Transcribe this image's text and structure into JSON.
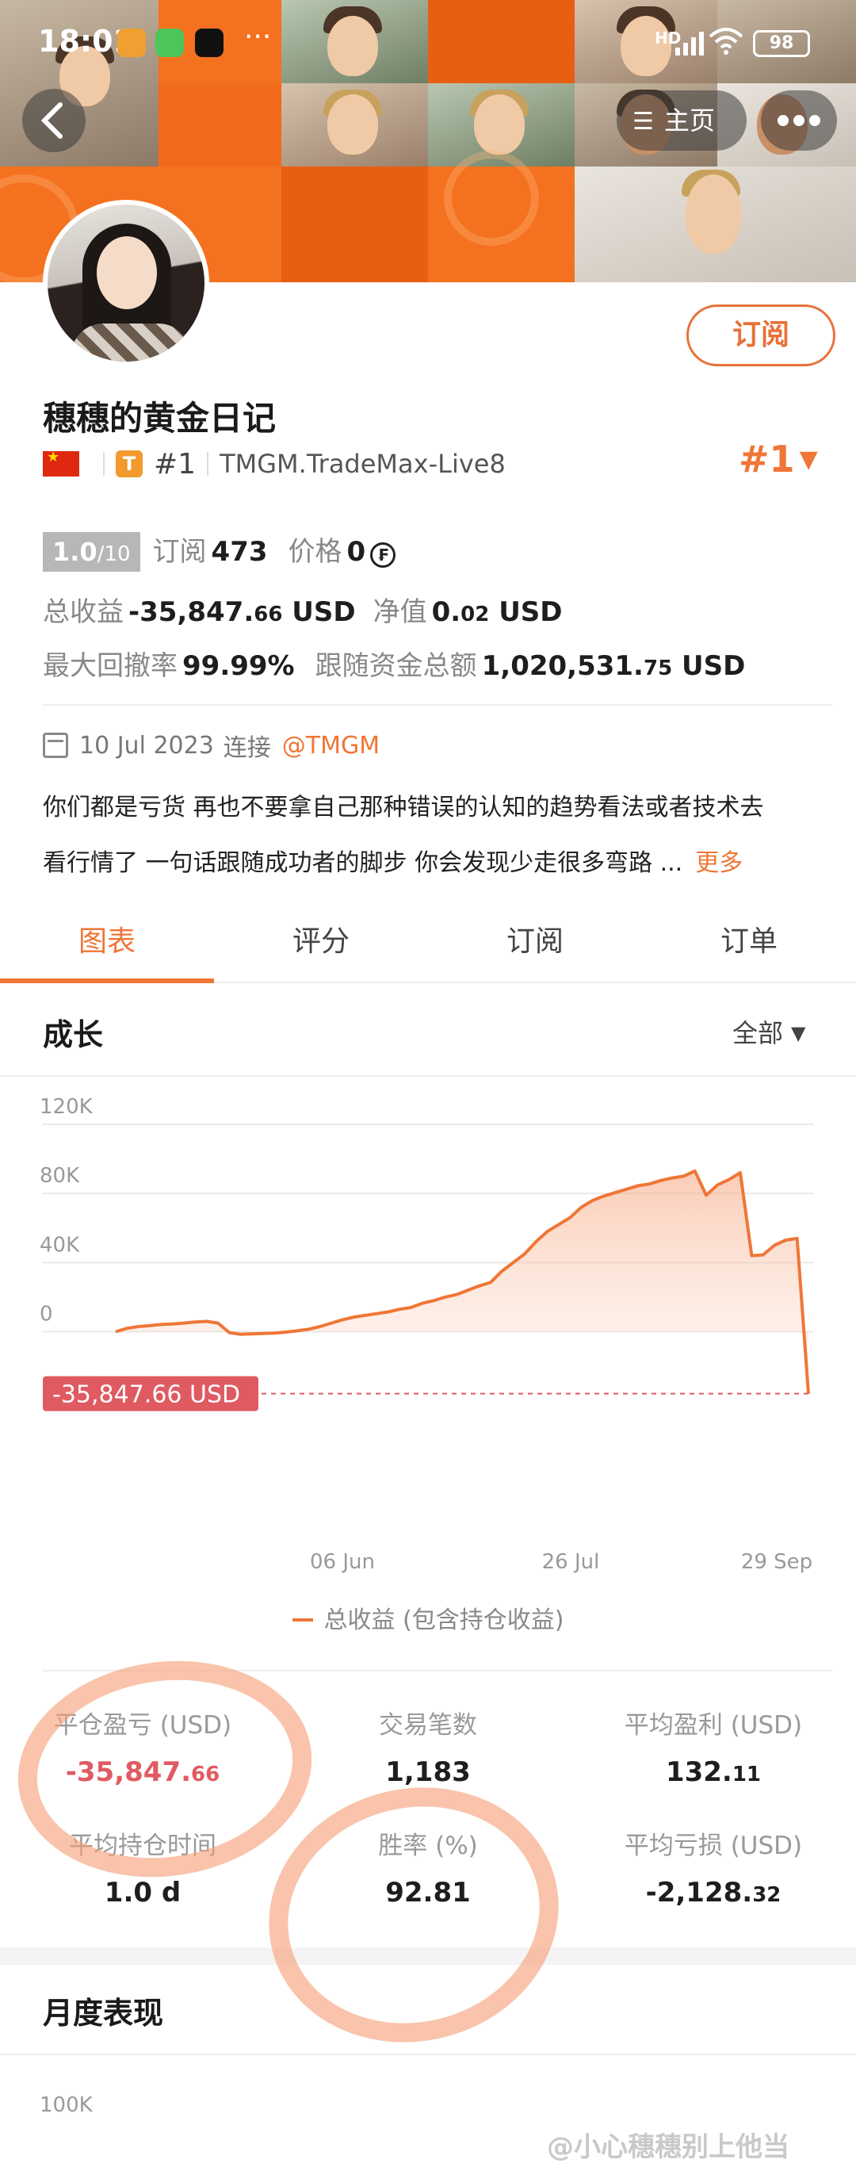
{
  "status_bar": {
    "time": "18:01",
    "overflow": "···",
    "hd": "HD",
    "battery": "98"
  },
  "nav": {
    "back_icon": "chevron-left-icon",
    "home_label": "主页",
    "more_icon": "more-dots-icon"
  },
  "profile": {
    "name": "穗穗的黄金日记",
    "tier_badge": "T",
    "rank_small": "#1",
    "account": "TMGM.TradeMax-Live8",
    "rank_big": "#1",
    "subscribe_label": "订阅"
  },
  "stats": {
    "score": "1.0",
    "score_max": "/10",
    "subs_label": "订阅",
    "subs_value": "473",
    "price_label": "价格",
    "price_value": "0",
    "coin_symbol": "₣",
    "total_label": "总收益",
    "total_value": "-35,847.",
    "total_cents": "66",
    "total_unit": "USD",
    "nav_label": "净值",
    "nav_value": "0.",
    "nav_cents": "02",
    "nav_unit": "USD",
    "dd_label": "最大回撤率",
    "dd_value": "99.99%",
    "follow_label": "跟随资金总额",
    "follow_value": "1,020,531.",
    "follow_cents": "75",
    "follow_unit": "USD"
  },
  "join": {
    "date": "10 Jul 2023",
    "connect_label": "连接",
    "broker": "@TMGM"
  },
  "description": {
    "line1": "你们都是亏货 再也不要拿自己那种错误的认知的趋势看法或者技术去",
    "line2": "看行情了 一句话跟随成功者的脚步 你会发现少走很多弯路 ...",
    "more_label": "更多"
  },
  "tabs": [
    {
      "label": "图表",
      "active": true
    },
    {
      "label": "评分",
      "active": false
    },
    {
      "label": "订阅",
      "active": false
    },
    {
      "label": "订单",
      "active": false
    }
  ],
  "growth": {
    "title": "成长",
    "filter_label": "全部"
  },
  "chart_data": {
    "type": "area",
    "title": "",
    "ylabel": "",
    "xlabel": "",
    "ylim": [
      -36000,
      120000
    ],
    "y_ticks": [
      "120K",
      "80K",
      "40K",
      "0"
    ],
    "y_tick_values": [
      120000,
      80000,
      40000,
      0
    ],
    "x_ticks": [
      "06 Jun",
      "26 Jul",
      "29 Sep"
    ],
    "current_value_label": "-35,847.66 USD",
    "current_value": -35847.66,
    "series": [
      {
        "name": "总收益 (包含持仓收益)",
        "color": "#ef7637",
        "values": [
          0,
          2000,
          3000,
          3500,
          4200,
          4500,
          5000,
          5600,
          6000,
          5000,
          -500,
          -1500,
          -1200,
          -1000,
          -800,
          -200,
          500,
          1500,
          3000,
          5000,
          7000,
          8500,
          9500,
          10500,
          11500,
          13000,
          14000,
          16500,
          18000,
          20000,
          21500,
          24000,
          26500,
          28500,
          35000,
          40000,
          45000,
          52000,
          58000,
          62000,
          66000,
          72000,
          76000,
          78500,
          80500,
          82500,
          84500,
          85500,
          87500,
          89000,
          90000,
          93000,
          79000,
          85000,
          88000,
          92000,
          44000,
          44500,
          50000,
          53000,
          54000,
          -35847.66
        ]
      }
    ]
  },
  "summary": {
    "closed_pnl_label": "平仓盈亏 (USD)",
    "closed_pnl_value": "-35,847.",
    "closed_pnl_cents": "66",
    "trades_label": "交易笔数",
    "trades_value": "1,183",
    "avg_profit_label": "平均盈利 (USD)",
    "avg_profit_value": "132.",
    "avg_profit_cents": "11",
    "hold_label": "平均持仓时间",
    "hold_value": "1.0 d",
    "winrate_label": "胜率 (%)",
    "winrate_value": "92.81",
    "avg_loss_label": "平均亏损 (USD)",
    "avg_loss_value": "-2,128.",
    "avg_loss_cents": "32"
  },
  "monthly": {
    "title": "月度表现",
    "first_tick": "100K"
  },
  "watermark": "@小心穗穗别上他当",
  "colors": {
    "accent": "#ef7637",
    "negative": "#e05a62",
    "banner": "#f26a1b"
  }
}
